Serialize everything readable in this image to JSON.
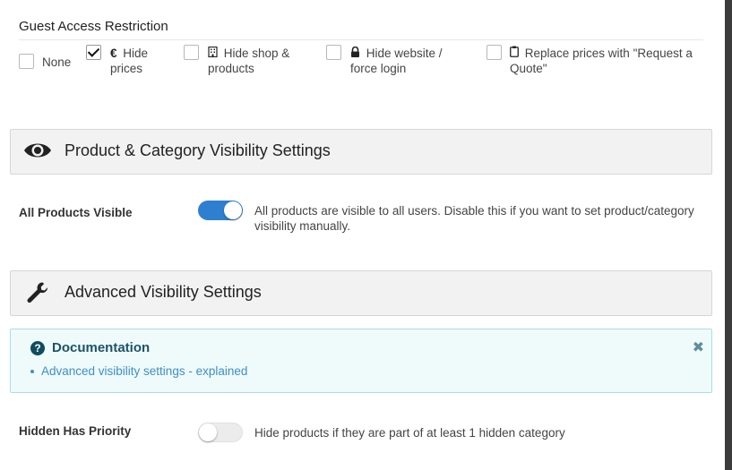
{
  "guest_access": {
    "title": "Guest Access Restriction",
    "options": [
      {
        "label": "None",
        "icon": "",
        "checked": false
      },
      {
        "label": "Hide prices",
        "icon": "€",
        "checked": true
      },
      {
        "label": "Hide shop & products",
        "icon": "building-icon",
        "checked": false
      },
      {
        "label": "Hide website / force login",
        "icon": "lock-icon",
        "checked": false
      },
      {
        "label": "Replace prices with \"Request a Quote\"",
        "icon": "clipboard-icon",
        "checked": false
      }
    ]
  },
  "visibility_section": {
    "title": "Product & Category Visibility Settings",
    "icon": "eye-icon"
  },
  "all_products_visible": {
    "label": "All Products Visible",
    "enabled": true,
    "description": "All products are visible to all users. Disable this if you want to set product/category visibility manually."
  },
  "advanced_section": {
    "title": "Advanced Visibility Settings",
    "icon": "wrench-icon"
  },
  "documentation": {
    "title": "Documentation",
    "link_text": "Advanced visibility settings - explained",
    "close_symbol": "✖"
  },
  "hidden_priority": {
    "label": "Hidden Has Priority",
    "enabled": false,
    "description": "Hide products if they are part of at least 1 hidden category"
  },
  "colors": {
    "toggle_on": "#2f7fd0",
    "doc_background": "#effafb",
    "doc_border": "#abdde6",
    "link": "#3e8fc4"
  }
}
